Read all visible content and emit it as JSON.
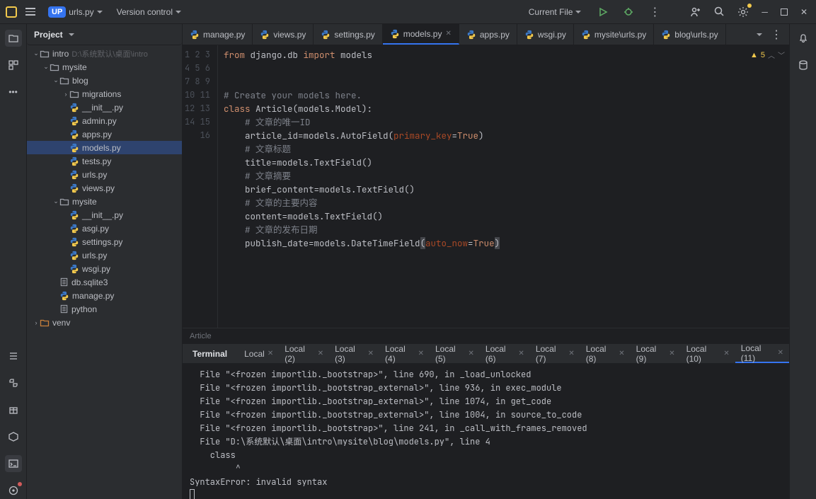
{
  "title": {
    "project_badge": "UP",
    "filename_dd": "urls.py",
    "version_control": "Version control",
    "run_config": "Current File"
  },
  "project_panel": {
    "header": "Project",
    "root": "intro",
    "root_hint": "D:\\系统默认\\桌面\\intro",
    "mysite": "mysite",
    "blog": "blog",
    "migrations": "migrations",
    "files_blog": [
      "__init__.py",
      "admin.py",
      "apps.py",
      "models.py",
      "tests.py",
      "urls.py",
      "views.py"
    ],
    "mysite2": "mysite",
    "files_mysite": [
      "__init__.py",
      "asgi.py",
      "settings.py",
      "urls.py",
      "wsgi.py"
    ],
    "db": "db.sqlite3",
    "manage": "manage.py",
    "python": "python",
    "venv": "venv"
  },
  "tabs": [
    "manage.py",
    "views.py",
    "settings.py",
    "models.py",
    "apps.py",
    "wsgi.py",
    "mysite\\urls.py",
    "blog\\urls.py"
  ],
  "active_tab_index": 3,
  "problems_count": "5",
  "breadcrumb": "Article",
  "code_lines": [
    {
      "n": 1,
      "html": "<span class='kw'>from</span> django.db <span class='kw'>import</span> models"
    },
    {
      "n": 2,
      "html": ""
    },
    {
      "n": 3,
      "html": ""
    },
    {
      "n": 4,
      "html": "<span class='comment'># Create your models here.</span>"
    },
    {
      "n": 5,
      "html": "<span class='kw'>class</span> Article(models.Model):"
    },
    {
      "n": 6,
      "html": "    <span class='comment'># 文章的唯一ID</span>"
    },
    {
      "n": 7,
      "html": "    article_id=models.AutoField(<span class='str-arg'>primary_key</span>=<span class='kw'>True</span>)"
    },
    {
      "n": 8,
      "html": "    <span class='comment'># 文章标题</span>"
    },
    {
      "n": 9,
      "html": "    title=models.TextField()"
    },
    {
      "n": 10,
      "html": "    <span class='comment'># 文章摘要</span>"
    },
    {
      "n": 11,
      "html": "    brief_content=models.TextField()"
    },
    {
      "n": 12,
      "html": "    <span class='comment'># 文章的主要内容</span>"
    },
    {
      "n": 13,
      "html": "    content=models.TextField()"
    },
    {
      "n": 14,
      "html": "    <span class='comment'># 文章的发布日期</span>"
    },
    {
      "n": 15,
      "html": "    publish_date=models.DateTimeField<span class='paren-hi'>(</span><span class='str-arg'>auto_now</span>=<span class='kw'>True</span><span class='paren-hi'>)</span>"
    },
    {
      "n": 16,
      "html": ""
    }
  ],
  "bottom_tabs": {
    "terminal": "Terminal",
    "items": [
      "Local",
      "Local (2)",
      "Local (3)",
      "Local (4)",
      "Local (5)",
      "Local (6)",
      "Local (7)",
      "Local (8)",
      "Local (9)",
      "Local (10)",
      "Local (11)"
    ],
    "active_index": 10
  },
  "terminal_output": "  File \"<frozen importlib._bootstrap>\", line 690, in _load_unlocked\n  File \"<frozen importlib._bootstrap_external>\", line 936, in exec_module\n  File \"<frozen importlib._bootstrap_external>\", line 1074, in get_code\n  File \"<frozen importlib._bootstrap_external>\", line 1004, in source_to_code\n  File \"<frozen importlib._bootstrap>\", line 241, in _call_with_frames_removed\n  File \"D:\\系统默认\\桌面\\intro\\mysite\\blog\\models.py\", line 4\n    class\n         ^\nSyntaxError: invalid syntax"
}
